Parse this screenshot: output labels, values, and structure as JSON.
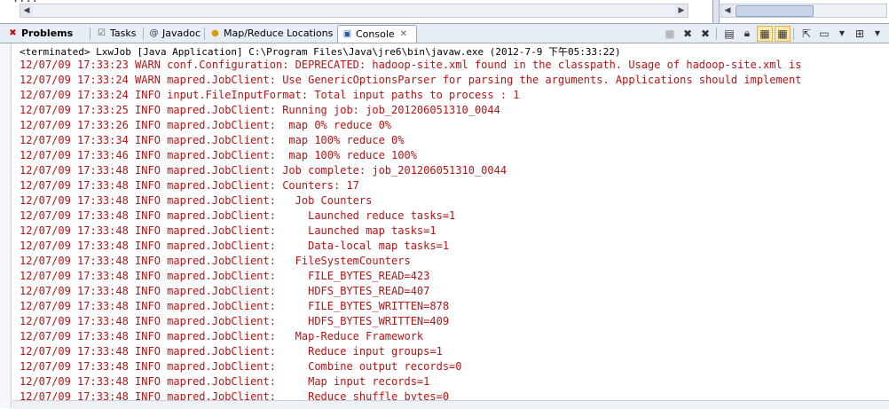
{
  "top_strip": {
    "code_fragment": "...."
  },
  "tabs": [
    {
      "label": "Problems",
      "icon": "problems-icon",
      "active": false,
      "bold": true
    },
    {
      "label": "Tasks",
      "icon": "tasks-icon",
      "active": false
    },
    {
      "label": "Javadoc",
      "icon": "javadoc-icon",
      "active": false
    },
    {
      "label": "Map/Reduce Locations",
      "icon": "mapreduce-icon",
      "active": false
    },
    {
      "label": "Console",
      "icon": "console-icon",
      "active": true
    }
  ],
  "console": {
    "header": "<terminated> LxwJob [Java Application] C:\\Program Files\\Java\\jre6\\bin\\javaw.exe (2012-7-9 下午05:33:22)",
    "lines": [
      "12/07/09 17:33:23 WARN conf.Configuration: DEPRECATED: hadoop-site.xml found in the classpath. Usage of hadoop-site.xml is",
      "12/07/09 17:33:24 WARN mapred.JobClient: Use GenericOptionsParser for parsing the arguments. Applications should implement",
      "12/07/09 17:33:24 INFO input.FileInputFormat: Total input paths to process : 1",
      "12/07/09 17:33:25 INFO mapred.JobClient: Running job: job_201206051310_0044",
      "12/07/09 17:33:26 INFO mapred.JobClient:  map 0% reduce 0%",
      "12/07/09 17:33:34 INFO mapred.JobClient:  map 100% reduce 0%",
      "12/07/09 17:33:46 INFO mapred.JobClient:  map 100% reduce 100%",
      "12/07/09 17:33:48 INFO mapred.JobClient: Job complete: job_201206051310_0044",
      "12/07/09 17:33:48 INFO mapred.JobClient: Counters: 17",
      "12/07/09 17:33:48 INFO mapred.JobClient:   Job Counters",
      "12/07/09 17:33:48 INFO mapred.JobClient:     Launched reduce tasks=1",
      "12/07/09 17:33:48 INFO mapred.JobClient:     Launched map tasks=1",
      "12/07/09 17:33:48 INFO mapred.JobClient:     Data-local map tasks=1",
      "12/07/09 17:33:48 INFO mapred.JobClient:   FileSystemCounters",
      "12/07/09 17:33:48 INFO mapred.JobClient:     FILE_BYTES_READ=423",
      "12/07/09 17:33:48 INFO mapred.JobClient:     HDFS_BYTES_READ=407",
      "12/07/09 17:33:48 INFO mapred.JobClient:     FILE_BYTES_WRITTEN=878",
      "12/07/09 17:33:48 INFO mapred.JobClient:     HDFS_BYTES_WRITTEN=409",
      "12/07/09 17:33:48 INFO mapred.JobClient:   Map-Reduce Framework",
      "12/07/09 17:33:48 INFO mapred.JobClient:     Reduce input groups=1",
      "12/07/09 17:33:48 INFO mapred.JobClient:     Combine output records=0",
      "12/07/09 17:33:48 INFO mapred.JobClient:     Map input records=1",
      "12/07/09 17:33:48 INFO mapred.JobClient:     Reduce shuffle bytes=0"
    ]
  },
  "colors": {
    "stderr_text": "#b31414",
    "tabbar_bg": "#e7edf5"
  }
}
